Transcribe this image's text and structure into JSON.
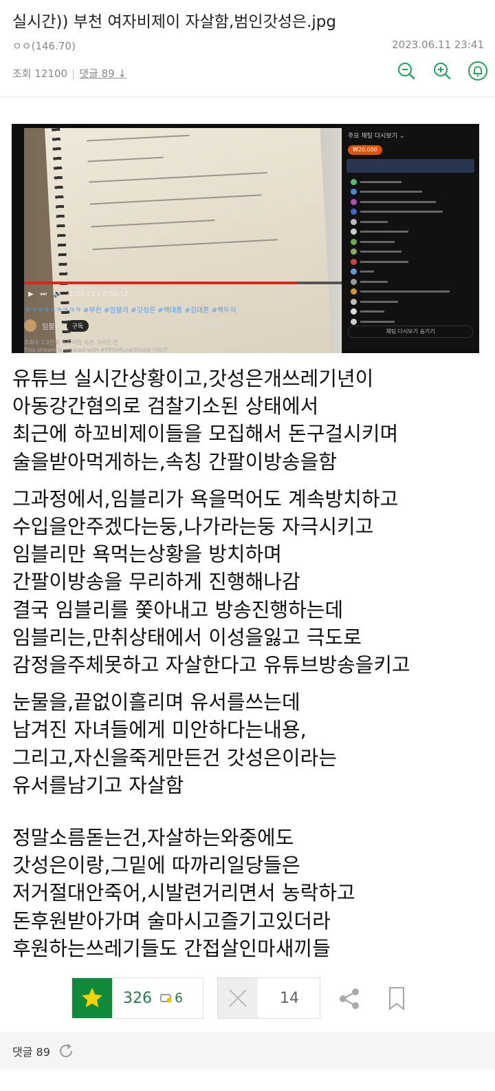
{
  "post": {
    "title": "실시간)) 부천 여자비제이 자살함,범인갓성은.jpg",
    "author": "ㅇㅇ(146.70)",
    "date": "2023.06.11 23:41",
    "views_label": "조회 12100",
    "comments_label": "댓글 89",
    "arrow": "↓"
  },
  "icons": {
    "zoom_out": "zoom-out-icon",
    "zoom_in": "zoom-in-icon",
    "bell": "bell-icon",
    "accent": "#1fa35a"
  },
  "video": {
    "time": "2:31:21 / 2:38:18",
    "hashtags": "ㅋㅋㅋㅋㅋㅋㅋㅋㅋ #부천 #임블리 #갓성은 #백대흠 #김대흔 #백두식",
    "channel_name": "임블리",
    "subscribe": "구독",
    "likes": "152",
    "share": "공유",
    "thanks": "Thanks",
    "desc_line1": "조회수 1.2만회 스트리밍 시간: 3시간 전",
    "desc_line2": "This stream is created with #PRISMLiveStudio 더보기",
    "chat_header": "주요 채팅 다시보기 ⌄",
    "super_chat": "₩20,000",
    "chat_footer": "채팅 다시보기 숨기기",
    "progress_fraction": 0.86
  },
  "body": {
    "para1": [
      "유튜브 실시간상황이고,갓성은개쓰레기년이",
      "아동강간혐의로 검찰기소된 상태에서",
      "최근에 하꼬비제이들을 모집해서 돈구걸시키며",
      "술을받아먹게하는,속칭 간팔이방송을함"
    ],
    "para2": [
      "그과정에서,임블리가 욕을먹어도 계속방치하고",
      "수입을안주겠다는둥,나가라는둥 자극시키고",
      "임블리만 욕먹는상황을 방치하며",
      "간팔이방송을 무리하게 진행해나감",
      "결국 임블리를 쫓아내고 방송진행하는데",
      "임블리는,만취상태에서 이성을잃고 극도로",
      "감정을주체못하고 자살한다고 유튜브방송을키고"
    ],
    "para3": [
      "눈물을,끝없이흘리며 유서를쓰는데",
      "남겨진 자녀들에게 미안하다는내용,",
      "그리고,자신을죽게만든건 갓성은이라는",
      "유서를남기고 자살함"
    ],
    "para4": [
      "정말소름돋는건,자살하는와중에도",
      "갓성은이랑,그밑에 따까리일당들은",
      "저거절대안죽어,시발련거리면서 농락하고",
      "돈후원받아가며 술마시고즐기고있더라",
      "후원하는쓰레기들도 간접살인마새끼들"
    ]
  },
  "actions": {
    "upvotes": "326",
    "gold": "6",
    "downvotes": "14"
  },
  "footer": {
    "comments": "댓글 89"
  }
}
